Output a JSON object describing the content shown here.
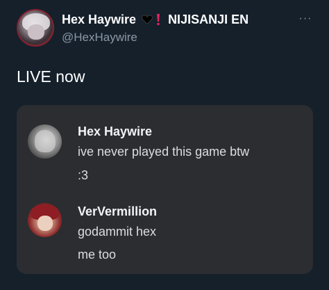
{
  "tweet": {
    "display_name": "Hex Haywire",
    "heart_emoji": "black-heart-icon",
    "exclaim_emoji": "red-exclamation-icon",
    "affiliation": "NIJISANJI EN",
    "handle": "@HexHaywire",
    "more_icon": "more-options-icon",
    "text": "LIVE now"
  },
  "chat": {
    "messages": [
      {
        "author": "Hex Haywire",
        "lines": [
          "ive never played this game btw",
          ":3"
        ]
      },
      {
        "author": "VerVermillion",
        "lines": [
          "godammit hex",
          "me too"
        ]
      }
    ]
  },
  "colors": {
    "background": "#15202b",
    "card": "#2b2d31",
    "handle": "#8b98a5",
    "exclaim": "#e0245e"
  }
}
